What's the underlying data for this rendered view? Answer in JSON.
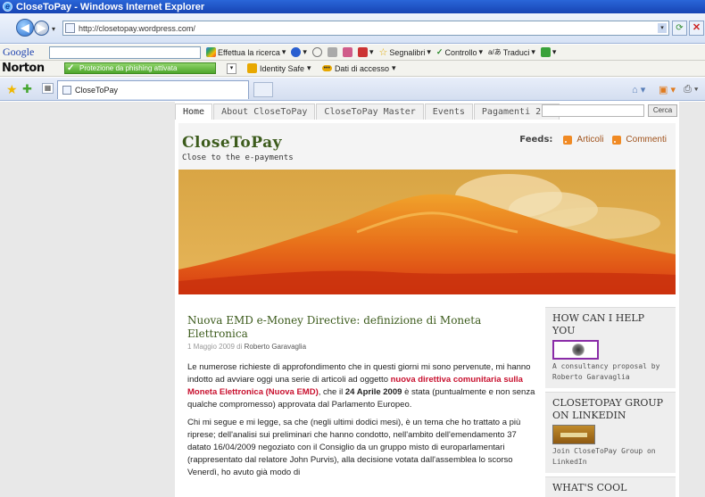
{
  "window": {
    "title": "CloseToPay - Windows Internet Explorer"
  },
  "address": {
    "url": "http://closetopay.wordpress.com/"
  },
  "google_toolbar": {
    "logo": "Google",
    "search_label": "Effettua la ricerca",
    "bookmarks": "Segnalibri",
    "check": "Controllo",
    "translate": "Traduci"
  },
  "norton_toolbar": {
    "logo": "Norton",
    "phishing": "Protezione da phishing attivata",
    "identity": "Identity Safe",
    "login_data": "Dati di accesso"
  },
  "tabs": {
    "active_title": "CloseToPay"
  },
  "site": {
    "nav": [
      "Home",
      "About CloseToPay",
      "CloseToPay Master",
      "Events",
      "Pagamenti 2.0"
    ],
    "search_button": "Cerca",
    "title": "CloseToPay",
    "tagline": "Close to the e-payments",
    "feeds_label": "Feeds:",
    "feed_articles": "Articoli",
    "feed_comments": "Commenti"
  },
  "post": {
    "title": "Nuova EMD e-Money Directive: definizione di Moneta Elettronica",
    "date": "1 Maggio 2009",
    "by": "di",
    "author": "Roberto Garavaglia",
    "p1_a": "Le numerose richieste di approfondimento che in questi giorni mi sono pervenute, mi hanno indotto ad avviare oggi una serie di articoli ad oggetto",
    "p1_link": "nuova direttiva comunitaria sulla Moneta Elettronica (Nuova EMD)",
    "p1_b": ", che il",
    "p1_date": "24 Aprile 2009",
    "p1_c": "è stata (puntualmente e non senza qualche compromesso) approvata dal Parlamento Europeo.",
    "p2": "Chi mi segue e mi legge, sa che (negli ultimi dodici mesi), è un tema che ho trattato a più riprese; dell'analisi sui preliminari che hanno condotto, nell'ambito dell'emendamento 37 datato 16/04/2009 negoziato con il Consiglio da un gruppo misto di europarlamentari (rappresentato dal relatore John Purvis), alla decisione votata dall'assemblea lo scorso Venerdì, ho avuto già modo di"
  },
  "sidebar": {
    "w1_title": "HOW CAN I HELP YOU",
    "w1_text": "A consultancy proposal by Roberto Garavaglia",
    "w2_title": "CLOSETOPAY GROUP ON LINKEDIN",
    "w2_text": "Join CloseToPay Group on LinkedIn",
    "w3_title": "WHAT'S COOL"
  }
}
